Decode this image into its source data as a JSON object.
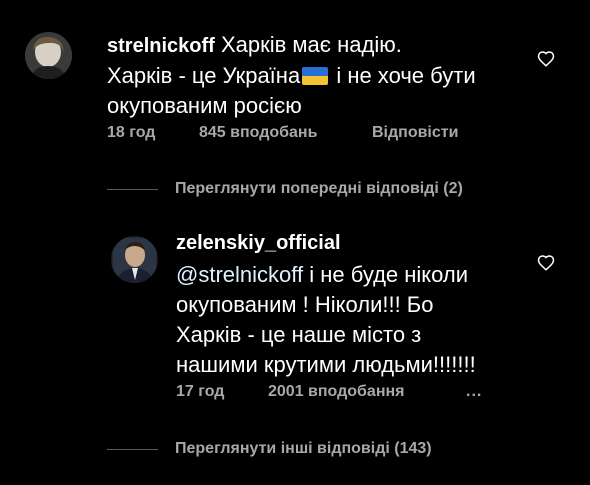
{
  "comments": [
    {
      "username": "strelnickoff",
      "text_line1": "Харків має надію.",
      "text_line2a": "Харків - це Україна",
      "text_line2b": "і не хоче бути",
      "text_line3": "окупованим росією",
      "time": "18 год",
      "likes": "845 вподобань",
      "reply": "Відповісти",
      "flag_icon": "ukraine-flag-emoji"
    },
    {
      "username": "zelenskiy_official",
      "mention": "@strelnickoff",
      "text_line1_rest": " і не буде ніколи",
      "text_line2": "окупованим ! Ніколи!!! Бо",
      "text_line3": "Харків - це наше місто з",
      "text_line4": "нашими крутими людьми!!!!!!!",
      "time": "17 год",
      "likes": "2001 вподобання",
      "more": "..."
    }
  ],
  "view_previous": "Переглянути попередні відповіді (2)",
  "view_other": "Переглянути інші відповіді (143)",
  "colors": {
    "background": "#000000",
    "text": "#ffffff",
    "muted": "#a8a8a8",
    "mention": "#e0f1ff"
  }
}
